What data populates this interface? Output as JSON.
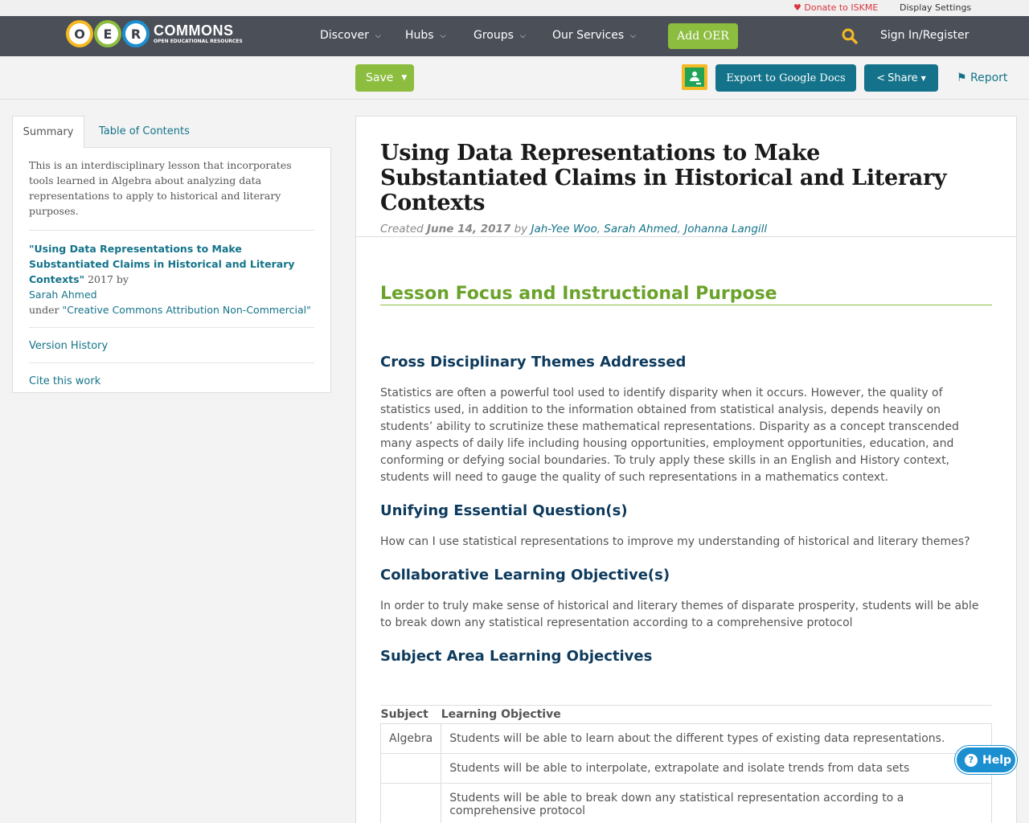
{
  "utility": {
    "donate": "Donate to ISKME",
    "display_settings": "Display Settings"
  },
  "nav": {
    "logo_big": "COMMONS",
    "logo_small": "OPEN EDUCATIONAL RESOURCES",
    "logo_letters": [
      "O",
      "E",
      "R"
    ],
    "items": [
      {
        "label": "Discover"
      },
      {
        "label": "Hubs"
      },
      {
        "label": "Groups"
      },
      {
        "label": "Our Services"
      }
    ],
    "add_oer": "Add OER",
    "sign_in": "Sign In/Register"
  },
  "toolbar": {
    "save": "Save",
    "export": "Export to Google Docs",
    "share": "Share",
    "report": "Report"
  },
  "sidebar": {
    "tabs": [
      "Summary",
      "Table of Contents"
    ],
    "summary": "This is an interdisciplinary lesson that incorporates tools learned in Algebra about analyzing data representations to apply to historical and literary purposes.",
    "attribution": {
      "title": "\"Using Data Representations to Make Substantiated Claims in Historical and Literary Contexts\"",
      "year_by": " 2017 by",
      "author": "Sarah Ahmed",
      "under": "under ",
      "license": "\"Creative Commons Attribution Non-Commercial\""
    },
    "version_history": "Version History",
    "cite": "Cite this work"
  },
  "main": {
    "title": "Using Data Representations to Make Substantiated Claims in Historical and Literary Contexts",
    "created": "Created ",
    "date": "June 14, 2017",
    "by": " by ",
    "authors": [
      "Jah-Yee Woo",
      "Sarah Ahmed",
      "Johanna Langill"
    ],
    "section_heading": "Lesson Focus and Instructional Purpose",
    "h_cross": "Cross Disciplinary Themes Addressed",
    "p_cross": "Statistics are often a powerful tool used to identify disparity when it occurs. However, the quality of statistics used, in addition to the information obtained from statistical analysis, depends heavily on students’ ability to scrutinize these mathematical representations. Disparity as a concept transcended many aspects of daily life including housing opportunities, employment opportunities, education, and conforming or defying social boundaries. To truly apply these skills in an English and History context, students will need to gauge the quality of such representations in a mathematics context.",
    "h_unifying": "Unifying Essential Question(s)",
    "p_unifying": "How can I use statistical representations to improve my understanding of historical and literary themes?",
    "h_collab": "Collaborative Learning Objective(s)",
    "p_collab": "In order to truly make sense of historical and literary themes of disparate prosperity, students will be able to break down any statistical representation according to a comprehensive protocol",
    "h_subject": "Subject Area Learning Objectives",
    "table": {
      "headers": [
        "Subject",
        "Learning Objective"
      ],
      "rows": [
        {
          "subject": "Algebra",
          "objective": "Students will be able to learn about the different types of existing data representations."
        },
        {
          "subject": "",
          "objective": "Students will be able to interpolate, extrapolate and isolate trends from data sets"
        },
        {
          "subject": "",
          "objective": "Students will be able to break down any statistical representation according to a comprehensive protocol"
        }
      ]
    }
  },
  "help": "Help"
}
